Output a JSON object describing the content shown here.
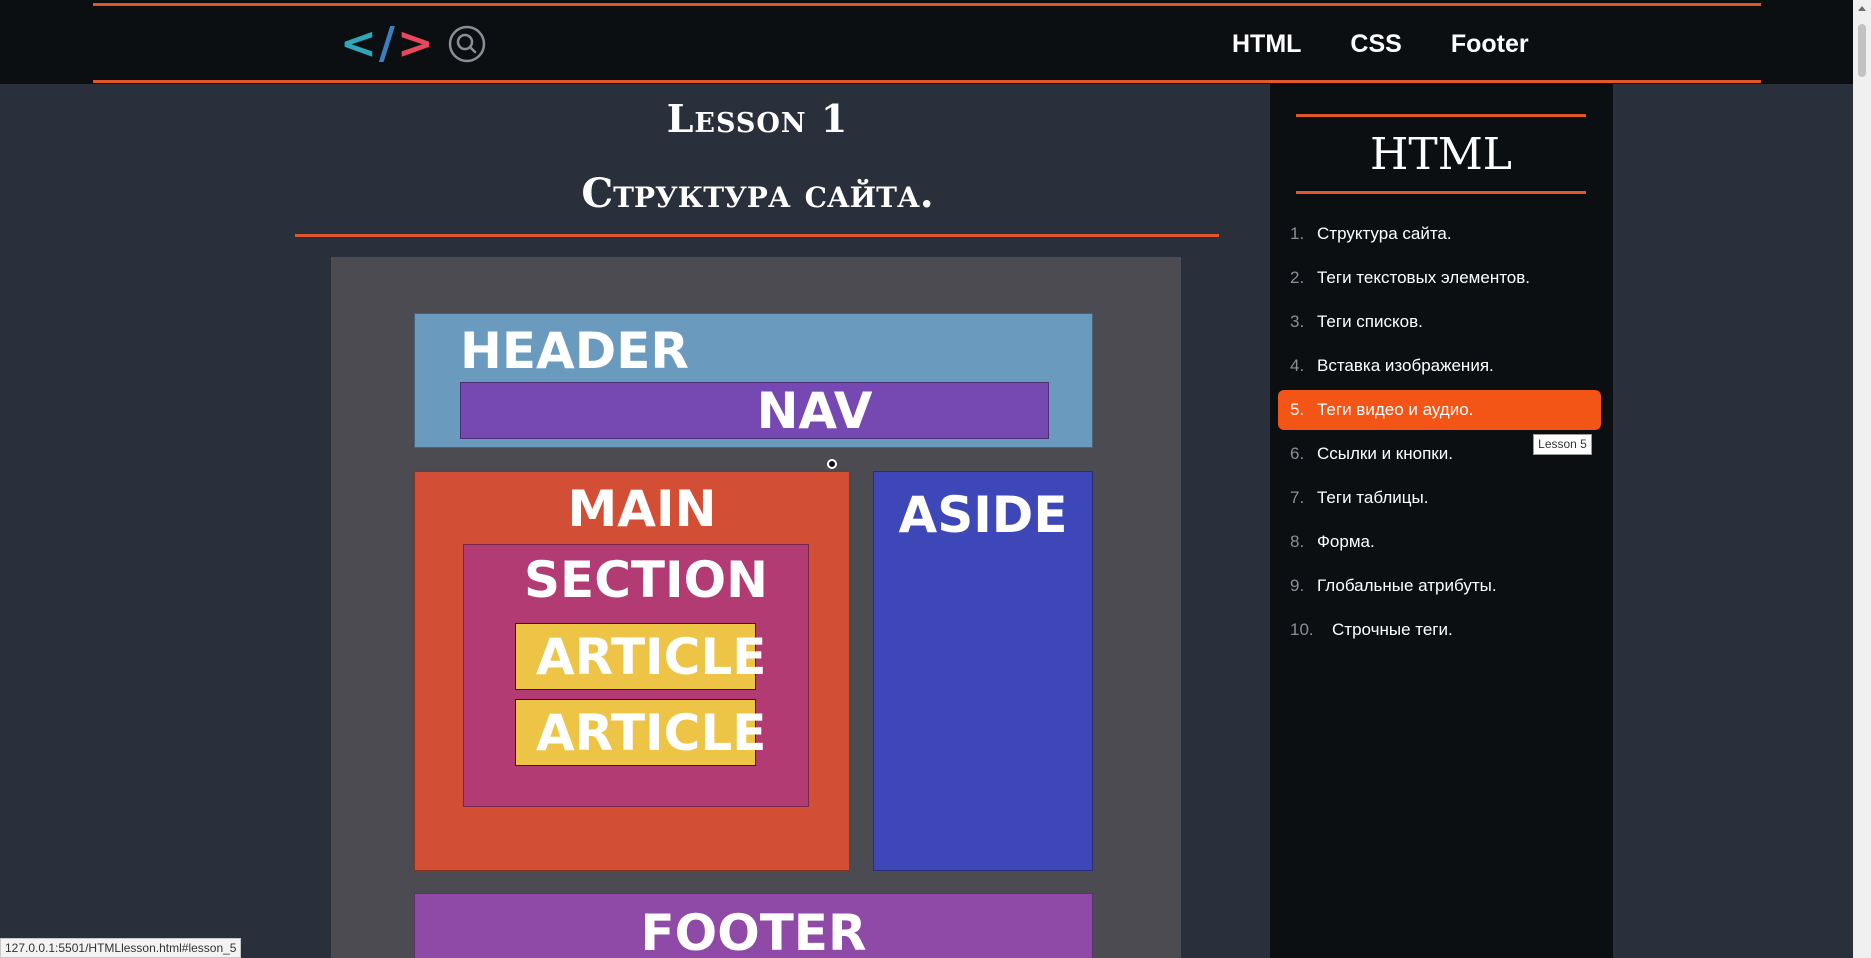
{
  "header": {
    "logo": {
      "left": "<",
      "slash": "/",
      "right": ">"
    },
    "nav": [
      "HTML",
      "CSS",
      "Footer"
    ]
  },
  "lesson": {
    "title": "Lesson 1",
    "subtitle": "Структура сайта."
  },
  "diagram": {
    "header": "HEADER",
    "nav": "NAV",
    "main": "MAIN",
    "section": "SECTION",
    "article1": "ARTICLE",
    "article2": "ARTICLE",
    "aside": "ASIDE",
    "footer": "FOOTER"
  },
  "sidebar": {
    "title": "HTML",
    "items": [
      {
        "num": "1.",
        "label": "Структура сайта."
      },
      {
        "num": "2.",
        "label": "Теги текстовых элементов."
      },
      {
        "num": "3.",
        "label": "Теги списков."
      },
      {
        "num": "4.",
        "label": "Вставка изображения."
      },
      {
        "num": "5.",
        "label": "Теги видео и аудио."
      },
      {
        "num": "6.",
        "label": "Ссылки и кнопки."
      },
      {
        "num": "7.",
        "label": "Теги таблицы."
      },
      {
        "num": "8.",
        "label": "Форма."
      },
      {
        "num": "9.",
        "label": "Глобальные атрибуты."
      },
      {
        "num": "10.",
        "label": "Строчные теги."
      }
    ],
    "active_index": 4,
    "tooltip": "Lesson 5"
  },
  "status_url": "127.0.0.1:5501/HTMLlesson.html#lesson_5",
  "colors": {
    "accent": "#e2572a",
    "active_item": "#f35516",
    "header_bg": "#0c0f12",
    "page_bg": "#2a303b"
  },
  "icons": {
    "logo": "code-brackets-icon",
    "search": "search-icon"
  }
}
